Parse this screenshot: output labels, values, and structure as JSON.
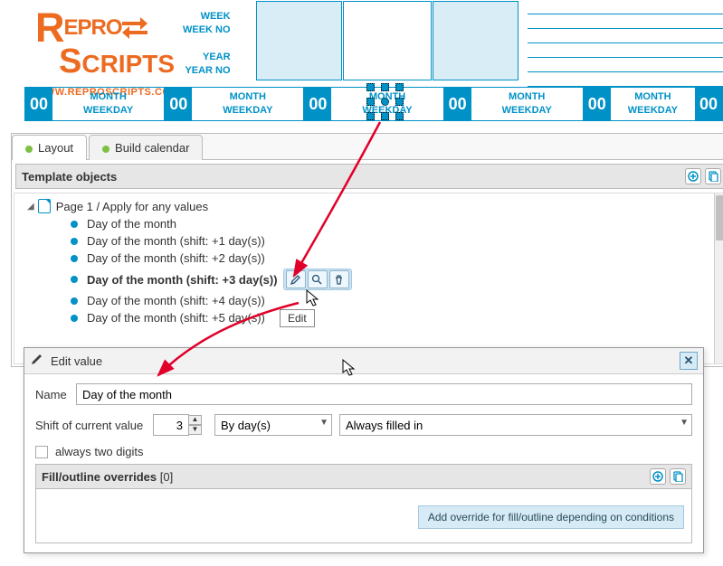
{
  "logo": {
    "url": "WWW.REPROSCRIPTS.COM",
    "name": "ReproScripts"
  },
  "hdr_labels": [
    "WEEK",
    "WEEK NO",
    "YEAR",
    "YEAR NO"
  ],
  "day_tab": {
    "num": "00",
    "month": "MONTH",
    "weekday": "WEEKDAY"
  },
  "tabs": {
    "layout": "Layout",
    "build": "Build calendar"
  },
  "section_title": "Template objects",
  "tree": {
    "root": "Page 1 / Apply for any values",
    "items": [
      "Day of the month",
      "Day of the month (shift: +1 day(s))",
      "Day of the month (shift: +2 day(s))",
      "Day of the month (shift: +3 day(s))",
      "Day of the month (shift: +4 day(s))",
      "Day of the month (shift: +5 day(s))"
    ]
  },
  "tooltip": "Edit",
  "dialog": {
    "title": "Edit value",
    "name_label": "Name",
    "name_value": "Day of the month",
    "shift_label": "Shift of current value",
    "shift_value": "3",
    "unit": "By day(s)",
    "fill_mode": "Always filled in",
    "two_digits": "always two digits",
    "overrides_title": "Fill/outline overrides",
    "overrides_count": "[0]",
    "add_override": "Add override for fill/outline depending on conditions"
  }
}
